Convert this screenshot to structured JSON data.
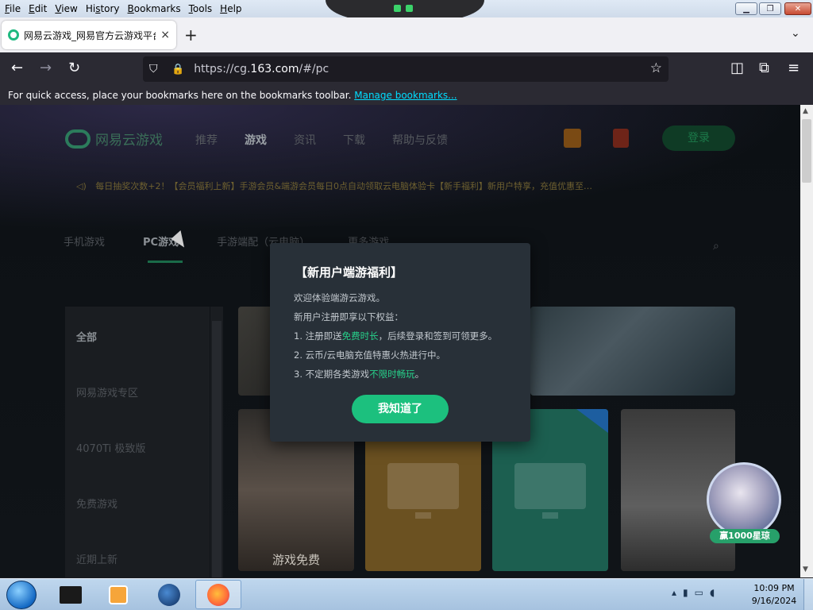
{
  "menubar": {
    "items": [
      {
        "pre": "",
        "key": "F",
        "post": "ile"
      },
      {
        "pre": "",
        "key": "E",
        "post": "dit"
      },
      {
        "pre": "",
        "key": "V",
        "post": "iew"
      },
      {
        "pre": "Hi",
        "key": "s",
        "post": "tory"
      },
      {
        "pre": "",
        "key": "B",
        "post": "ookmarks"
      },
      {
        "pre": "",
        "key": "T",
        "post": "ools"
      },
      {
        "pre": "",
        "key": "H",
        "post": "elp"
      }
    ]
  },
  "tab": {
    "title": "网易云游戏_网易官方云游戏平台",
    "close_icon": "×"
  },
  "newtab_icon": "+",
  "tablist_icon": "⌄",
  "nav": {
    "back_icon": "←",
    "forward_icon": "→",
    "reload_icon": "↻",
    "url_prefix": "https://cg.",
    "url_host": "163.com",
    "url_suffix": "/#/pc",
    "star_icon": "☆",
    "pocket_icon": "◫",
    "extensions_icon": "⧉",
    "menu_icon": "≡",
    "shield_icon": "⛉",
    "lock_icon": "🔒"
  },
  "bookmarks_bar": {
    "text": "For quick access, place your bookmarks here on the bookmarks toolbar.",
    "link": "Manage bookmarks..."
  },
  "site": {
    "logo_text": "网易云游戏",
    "nav": [
      "推荐",
      "游戏",
      "资讯",
      "下载",
      "帮助与反馈"
    ],
    "active_nav": "游戏",
    "login": "登录",
    "notice_icon": "◁)",
    "notice": "每日抽奖次数+2！【会员福利上新】手游会员&端游会员每日0点自动领取云电脑体验卡【新手福利】新用户特享，充值优惠至…",
    "categories": [
      "手机游戏",
      "PC游戏",
      "手游端配（云电脑）",
      "更多游戏"
    ],
    "active_category": "PC游戏",
    "search_icon": "⌕",
    "sidebar": [
      "全部",
      "网易游戏专区",
      "4070Ti 极致版",
      "免费游戏",
      "近期上新"
    ],
    "card_caption": "游戏免费",
    "promo_tag": "赢1000星琼"
  },
  "modal": {
    "title": "【新用户端游福利】",
    "line1": "欢迎体验端游云游戏。",
    "line2": "新用户注册即享以下权益：",
    "line3_pre": "1. 注册即送",
    "line3_hl": "免费时长",
    "line3_post": "，后续登录和签到可领更多。",
    "line4": "2. 云币/云电脑充值特惠火热进行中。",
    "line5_pre": "3. 不定期各类游戏",
    "line5_hl": "不限时畅玩",
    "line5_post": "。",
    "ok": "我知道了"
  },
  "taskbar": {
    "time": "10:09 PM",
    "date": "9/16/2024"
  },
  "window_controls": {
    "min": "▁",
    "max": "❐",
    "close": "✕"
  }
}
